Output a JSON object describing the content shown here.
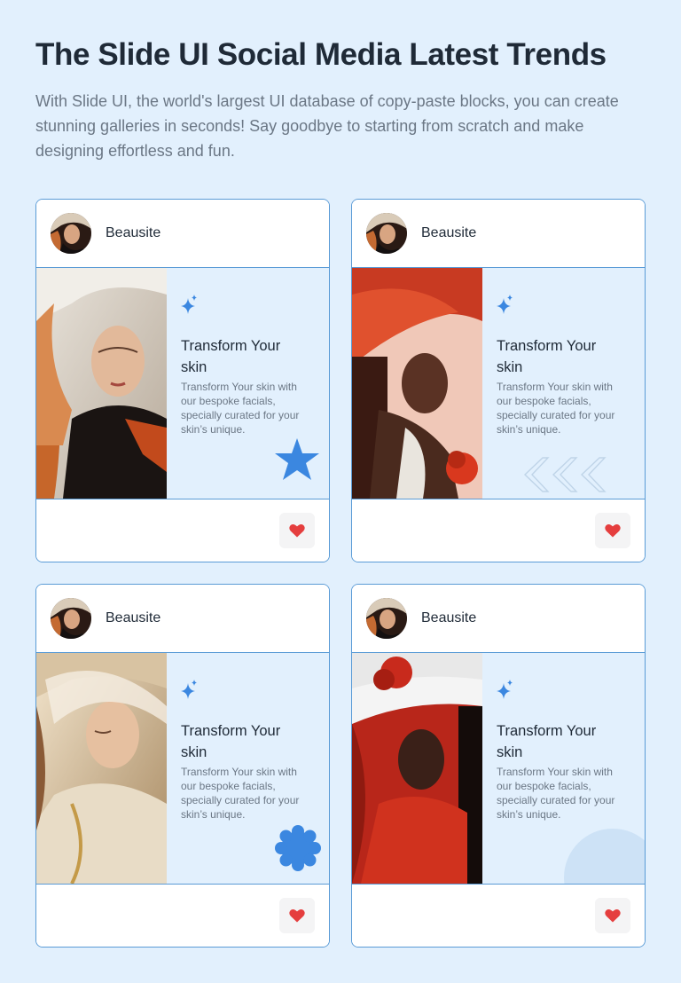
{
  "page": {
    "title": "The Slide UI Social Media Latest Trends",
    "subtitle": "With Slide UI, the world's largest UI database of copy-paste blocks, you can create stunning galleries in seconds! Say goodbye to starting from scratch and make designing effortless and fun."
  },
  "colors": {
    "background": "#e2f0fd",
    "card_border": "#5a9bd6",
    "accent_blue": "#3b87e0",
    "heart_red": "#e53e3e"
  },
  "cards": [
    {
      "author": "Beausite",
      "title": "Transform Your skin",
      "description": "Transform Your skin with our bespoke facials, specially curated for your skin’s unique.",
      "decoration": "star-icon",
      "like_icon": "heart-icon"
    },
    {
      "author": "Beausite",
      "title": "Transform Your skin",
      "description": "Transform Your skin with our bespoke facials, specially curated for your skin’s unique.",
      "decoration": "chevrons-left-icon",
      "like_icon": "heart-icon"
    },
    {
      "author": "Beausite",
      "title": "Transform Your skin",
      "description": "Transform Your skin with our bespoke facials, specially curated for your skin’s unique.",
      "decoration": "flower-badge-icon",
      "like_icon": "heart-icon"
    },
    {
      "author": "Beausite",
      "title": "Transform Your skin",
      "description": "Transform Your skin with our bespoke facials, specially curated for your skin’s unique.",
      "decoration": "circle-shape-icon",
      "like_icon": "heart-icon"
    }
  ]
}
